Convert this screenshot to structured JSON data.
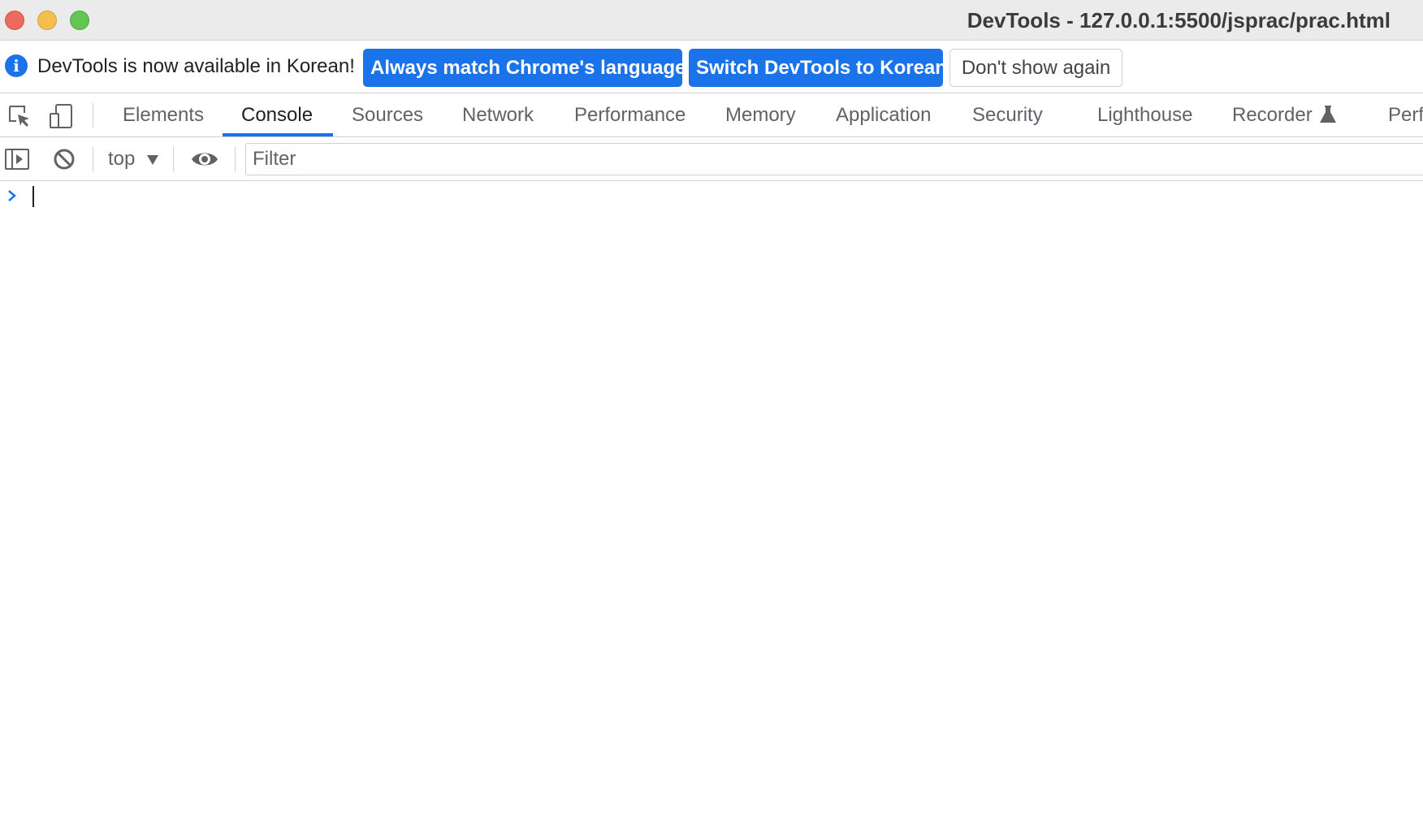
{
  "window": {
    "title": "DevTools - 127.0.0.1:5500/jsprac/prac.html"
  },
  "infobar": {
    "icon": "info-icon",
    "message": "DevTools is now available in Korean!",
    "match_language_label": "Always match Chrome's language",
    "switch_language_label": "Switch DevTools to Korean",
    "dismiss_label": "Don't show again"
  },
  "tabs": {
    "items": [
      {
        "label": "Elements"
      },
      {
        "label": "Console",
        "active": true
      },
      {
        "label": "Sources"
      },
      {
        "label": "Network"
      },
      {
        "label": "Performance"
      },
      {
        "label": "Memory"
      },
      {
        "label": "Application"
      },
      {
        "label": "Security"
      },
      {
        "label": "Lighthouse"
      },
      {
        "label": "Recorder"
      },
      {
        "label": "Perf"
      }
    ]
  },
  "console_toolbar": {
    "context": "top",
    "filter_placeholder": "Filter",
    "filter_value": ""
  },
  "colors": {
    "accent": "#1a73e8",
    "titlebar_bg": "#ebebeb",
    "text_primary": "#202124",
    "text_secondary": "#5f6368"
  }
}
